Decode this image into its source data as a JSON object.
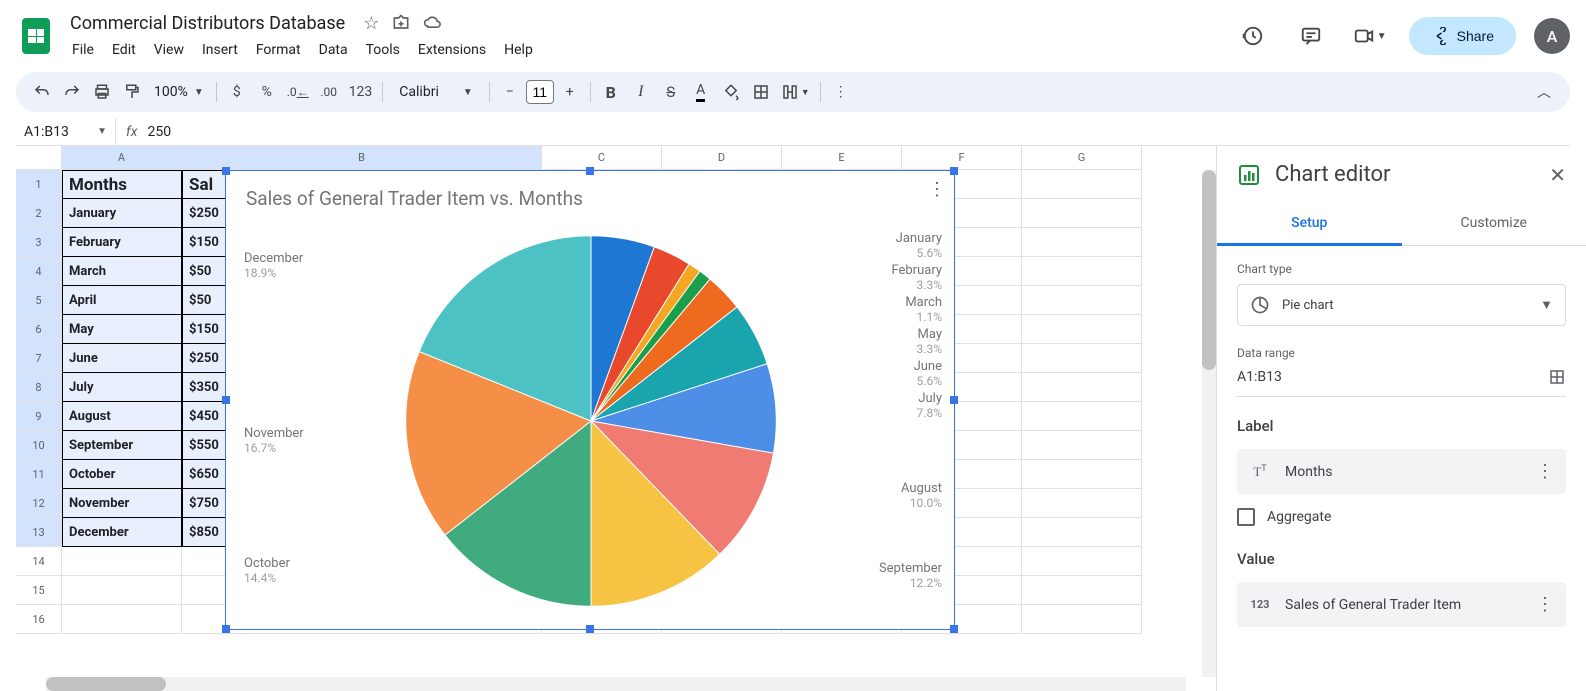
{
  "header": {
    "doc_title": "Commercial Distributors Database",
    "menus": [
      "File",
      "Edit",
      "View",
      "Insert",
      "Format",
      "Data",
      "Tools",
      "Extensions",
      "Help"
    ],
    "share_label": "Share",
    "avatar_initial": "A"
  },
  "toolbar": {
    "zoom": "100%",
    "font_name": "Calibri",
    "font_size": "11",
    "num_fmt_123": "123"
  },
  "formula_bar": {
    "name_box": "A1:B13",
    "fx_symbol": "fx",
    "value": "250"
  },
  "columns": [
    "A",
    "B",
    "C",
    "D",
    "E",
    "F",
    "G"
  ],
  "sheet": {
    "header_row": {
      "a": "Months",
      "b": "Sal"
    },
    "rows": [
      {
        "a": "January",
        "b": "$250"
      },
      {
        "a": "February",
        "b": "$150"
      },
      {
        "a": "March",
        "b": "$50"
      },
      {
        "a": "April",
        "b": "$50"
      },
      {
        "a": "May",
        "b": "$150"
      },
      {
        "a": "June",
        "b": "$250"
      },
      {
        "a": "July",
        "b": "$350"
      },
      {
        "a": "August",
        "b": "$450"
      },
      {
        "a": "September",
        "b": "$550"
      },
      {
        "a": "October",
        "b": "$650"
      },
      {
        "a": "November",
        "b": "$750"
      },
      {
        "a": "December",
        "b": "$850"
      }
    ]
  },
  "chart_data": {
    "type": "pie",
    "title": "Sales of General Trader Item vs. Months",
    "series": [
      {
        "name": "January",
        "value": 250,
        "pct": 5.6,
        "color": "#1f77d4"
      },
      {
        "name": "February",
        "value": 150,
        "pct": 3.3,
        "color": "#e8482b"
      },
      {
        "name": "March",
        "value": 50,
        "pct": 1.1,
        "color": "#f5a623"
      },
      {
        "name": "April",
        "value": 50,
        "pct": 1.1,
        "color": "#1b9e4b"
      },
      {
        "name": "May",
        "value": 150,
        "pct": 3.3,
        "color": "#ed6a1f"
      },
      {
        "name": "June",
        "value": 250,
        "pct": 5.6,
        "color": "#1aa4ae"
      },
      {
        "name": "July",
        "value": 350,
        "pct": 7.8,
        "color": "#4d8ee6"
      },
      {
        "name": "August",
        "value": 450,
        "pct": 10.0,
        "color": "#f07b72"
      },
      {
        "name": "September",
        "value": 550,
        "pct": 12.2,
        "color": "#f7c342"
      },
      {
        "name": "October",
        "value": 650,
        "pct": 14.4,
        "color": "#3fab7e"
      },
      {
        "name": "November",
        "value": 750,
        "pct": 16.7,
        "color": "#f58f47"
      },
      {
        "name": "December",
        "value": 850,
        "pct": 18.9,
        "color": "#4cc2c4"
      }
    ],
    "labels_visible": [
      {
        "name": "January",
        "pct": "5.6%"
      },
      {
        "name": "February",
        "pct": "3.3%"
      },
      {
        "name": "March",
        "pct": "1.1%"
      },
      {
        "name": "May",
        "pct": "3.3%"
      },
      {
        "name": "June",
        "pct": "5.6%"
      },
      {
        "name": "July",
        "pct": "7.8%"
      },
      {
        "name": "August",
        "pct": "10.0%"
      },
      {
        "name": "September",
        "pct": "12.2%"
      },
      {
        "name": "October",
        "pct": "14.4%",
        "side": "left"
      },
      {
        "name": "November",
        "pct": "16.7%",
        "side": "left"
      },
      {
        "name": "December",
        "pct": "18.9%",
        "side": "left"
      }
    ]
  },
  "editor": {
    "title": "Chart editor",
    "tab_setup": "Setup",
    "tab_customize": "Customize",
    "chart_type_label": "Chart type",
    "chart_type_value": "Pie chart",
    "data_range_label": "Data range",
    "data_range_value": "A1:B13",
    "label_section": "Label",
    "label_chip": "Months",
    "aggregate_label": "Aggregate",
    "value_section": "Value",
    "value_chip": "Sales of General Trader Item"
  }
}
